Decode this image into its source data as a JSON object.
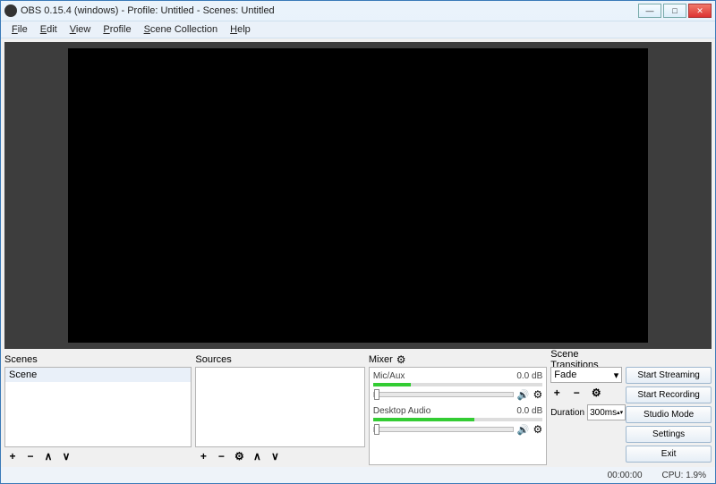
{
  "window": {
    "title": "OBS 0.15.4 (windows) - Profile: Untitled - Scenes: Untitled"
  },
  "menu": {
    "file": "File",
    "edit": "Edit",
    "view": "View",
    "profile": "Profile",
    "scene_collection": "Scene Collection",
    "help": "Help"
  },
  "panels": {
    "scenes_label": "Scenes",
    "sources_label": "Sources",
    "mixer_label": "Mixer",
    "transitions_label": "Scene Transitions"
  },
  "scenes": {
    "items": [
      {
        "label": "Scene"
      }
    ]
  },
  "mixer": {
    "tracks": [
      {
        "name": "Mic/Aux",
        "db": "0.0 dB",
        "fill_pct": 22
      },
      {
        "name": "Desktop Audio",
        "db": "0.0 dB",
        "fill_pct": 60
      }
    ]
  },
  "transition": {
    "selected": "Fade",
    "duration_label": "Duration",
    "duration_value": "300ms"
  },
  "buttons": {
    "start_streaming": "Start Streaming",
    "start_recording": "Start Recording",
    "studio_mode": "Studio Mode",
    "settings": "Settings",
    "exit": "Exit"
  },
  "status": {
    "time": "00:00:00",
    "cpu": "CPU: 1.9%"
  },
  "glyphs": {
    "plus": "+",
    "minus": "−",
    "up": "∧",
    "down": "∨",
    "gear": "⚙",
    "speaker": "🔊",
    "dropdown": "▾",
    "spin": "▴▾"
  }
}
